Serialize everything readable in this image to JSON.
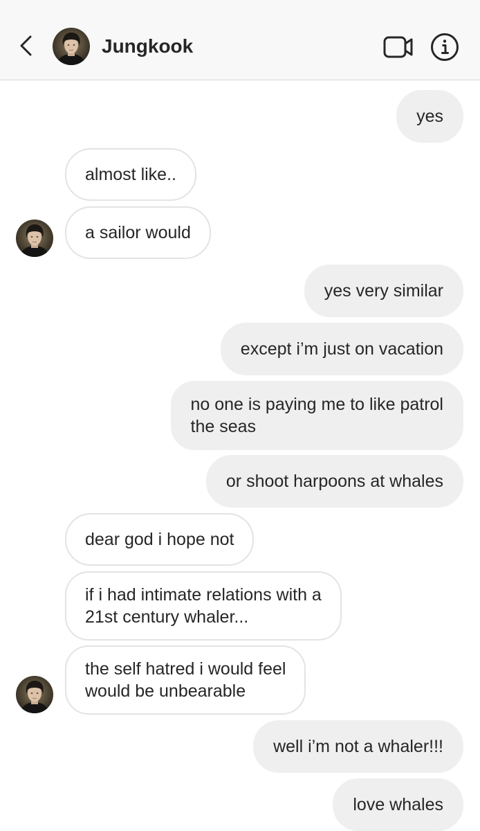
{
  "header": {
    "contact_name": "Jungkook",
    "back_icon": "chevron-left-icon",
    "video_icon": "video-camera-icon",
    "info_icon": "info-circle-icon"
  },
  "colors": {
    "outgoing_bubble": "#efefef",
    "incoming_border": "#e3e3e3",
    "header_bg": "#f8f8f8",
    "text": "#262626"
  },
  "messages": [
    {
      "direction": "out",
      "lines": [
        "yes"
      ]
    },
    {
      "direction": "in",
      "lines": [
        "almost like.."
      ]
    },
    {
      "direction": "in",
      "lines": [
        "a sailor would"
      ],
      "avatar": true
    },
    {
      "direction": "out",
      "lines": [
        "yes very similar"
      ]
    },
    {
      "direction": "out",
      "lines": [
        "except i’m just on vacation"
      ]
    },
    {
      "direction": "out",
      "lines": [
        "no one is paying me to like patrol",
        "the seas"
      ]
    },
    {
      "direction": "out",
      "lines": [
        "or shoot harpoons at whales"
      ]
    },
    {
      "direction": "in",
      "lines": [
        "dear god i hope not"
      ]
    },
    {
      "direction": "in",
      "lines": [
        "if i had intimate relations with a",
        "21st century whaler..."
      ]
    },
    {
      "direction": "in",
      "lines": [
        "the self hatred i would feel",
        "would be unbearable"
      ],
      "avatar": true
    },
    {
      "direction": "out",
      "lines": [
        "well i’m not a whaler!!!"
      ]
    },
    {
      "direction": "out",
      "lines": [
        "love whales"
      ]
    }
  ]
}
